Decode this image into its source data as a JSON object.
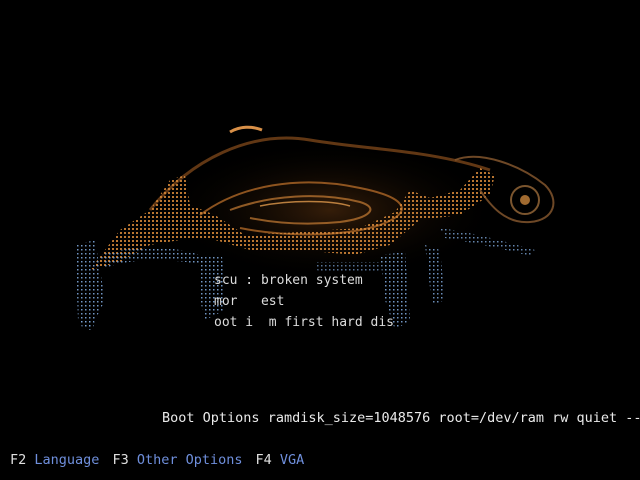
{
  "colors": {
    "background": "#000000",
    "text": "#e8e8e8",
    "fkey_label": "#6f8fdc",
    "art_orange": "#d98a3a",
    "art_blue": "#7da6d8"
  },
  "splash": {
    "icon": "chameleon-splash-art"
  },
  "menu": {
    "items": [
      {
        "label": "scu : broken system"
      },
      {
        "label": "mor   est"
      },
      {
        "label": "oot i  m first hard dis"
      }
    ]
  },
  "boot_options": {
    "label": "Boot Options",
    "value": "ramdisk_size=1048576 root=/dev/ram rw quiet --"
  },
  "function_keys": [
    {
      "key": "F2",
      "label": "Language"
    },
    {
      "key": "F3",
      "label": "Other Options"
    },
    {
      "key": "F4",
      "label": "VGA"
    }
  ]
}
